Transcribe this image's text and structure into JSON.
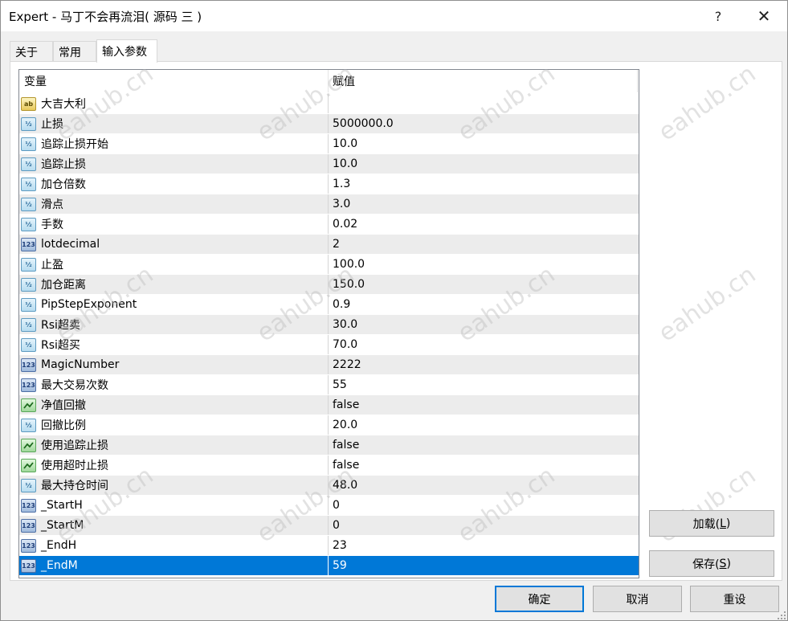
{
  "window": {
    "title": "Expert - 马丁不会再流泪( 源码 三 )",
    "help_label": "?",
    "close_label": "✕"
  },
  "tabs": [
    {
      "label": "关于",
      "active": false
    },
    {
      "label": "常用",
      "active": false
    },
    {
      "label": "输入参数",
      "active": true
    }
  ],
  "grid": {
    "columns": {
      "variable": "变量",
      "value": "赋值"
    },
    "rows": [
      {
        "icon": "string-icon",
        "glyph": "ab",
        "type": "string",
        "name": "大吉大利",
        "value": ""
      },
      {
        "icon": "double-icon",
        "glyph": "½",
        "type": "double",
        "name": "止损",
        "value": "5000000.0"
      },
      {
        "icon": "double-icon",
        "glyph": "½",
        "type": "double",
        "name": "追踪止损开始",
        "value": "10.0"
      },
      {
        "icon": "double-icon",
        "glyph": "½",
        "type": "double",
        "name": "追踪止损",
        "value": "10.0"
      },
      {
        "icon": "double-icon",
        "glyph": "½",
        "type": "double",
        "name": "加仓倍数",
        "value": "1.3"
      },
      {
        "icon": "double-icon",
        "glyph": "½",
        "type": "double",
        "name": "滑点",
        "value": "3.0"
      },
      {
        "icon": "double-icon",
        "glyph": "½",
        "type": "double",
        "name": "手数",
        "value": "0.02"
      },
      {
        "icon": "int-icon",
        "glyph": "123",
        "type": "int",
        "name": "lotdecimal",
        "value": "2"
      },
      {
        "icon": "double-icon",
        "glyph": "½",
        "type": "double",
        "name": "止盈",
        "value": "100.0"
      },
      {
        "icon": "double-icon",
        "glyph": "½",
        "type": "double",
        "name": "加仓距离",
        "value": "150.0"
      },
      {
        "icon": "double-icon",
        "glyph": "½",
        "type": "double",
        "name": "PipStepExponent",
        "value": "0.9"
      },
      {
        "icon": "double-icon",
        "glyph": "½",
        "type": "double",
        "name": "Rsi超卖",
        "value": "30.0"
      },
      {
        "icon": "double-icon",
        "glyph": "½",
        "type": "double",
        "name": "Rsi超买",
        "value": "70.0"
      },
      {
        "icon": "int-icon",
        "glyph": "123",
        "type": "int",
        "name": "MagicNumber",
        "value": "2222"
      },
      {
        "icon": "int-icon",
        "glyph": "123",
        "type": "int",
        "name": "最大交易次数",
        "value": "55"
      },
      {
        "icon": "bool-icon",
        "glyph": "",
        "type": "bool",
        "name": "净值回撤",
        "value": "false"
      },
      {
        "icon": "double-icon",
        "glyph": "½",
        "type": "double",
        "name": "回撤比例",
        "value": "20.0"
      },
      {
        "icon": "bool-icon",
        "glyph": "",
        "type": "bool",
        "name": "使用追踪止损",
        "value": "false"
      },
      {
        "icon": "bool-icon",
        "glyph": "",
        "type": "bool",
        "name": "使用超时止损",
        "value": "false"
      },
      {
        "icon": "double-icon",
        "glyph": "½",
        "type": "double",
        "name": "最大持仓时间",
        "value": "48.0"
      },
      {
        "icon": "int-icon",
        "glyph": "123",
        "type": "int",
        "name": "_StartH",
        "value": "0"
      },
      {
        "icon": "int-icon",
        "glyph": "123",
        "type": "int",
        "name": "_StartM",
        "value": "0"
      },
      {
        "icon": "int-icon",
        "glyph": "123",
        "type": "int",
        "name": "_EndH",
        "value": "23"
      },
      {
        "icon": "int-icon",
        "glyph": "123",
        "type": "int",
        "name": "_EndM",
        "value": "59",
        "selected": true
      }
    ]
  },
  "buttons": {
    "load": {
      "label": "加载(",
      "accel": "L",
      "suffix": ")"
    },
    "save": {
      "label": "保存(",
      "accel": "S",
      "suffix": ")"
    },
    "ok": "确定",
    "cancel": "取消",
    "reset": "重设"
  },
  "watermark_text": "eahub.cn",
  "colors": {
    "selection": "#0078d7",
    "row_alt": "#ececec",
    "default_button_border": "#0078d7"
  }
}
